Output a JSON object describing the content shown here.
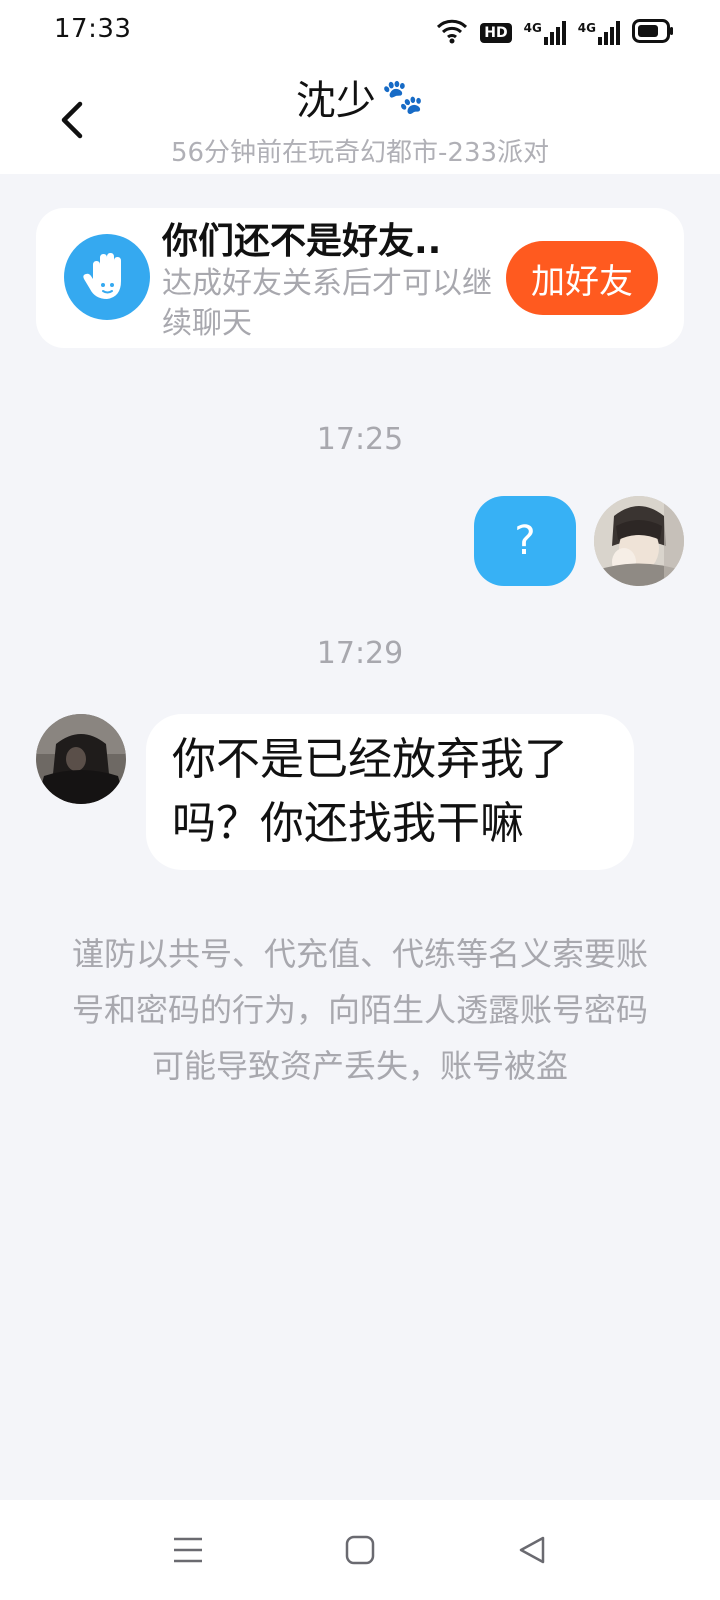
{
  "status_bar": {
    "time": "17:33",
    "icons": [
      "wifi-icon",
      "hd-icon",
      "signal-4g-icon",
      "signal-4g-icon",
      "battery-icon"
    ],
    "hd_label": "HD",
    "network_label_1": "4G",
    "network_label_2": "4G"
  },
  "header": {
    "title": "沈少",
    "title_emoji": "🐾",
    "subtitle": "56分钟前在玩奇幻都市-233派对"
  },
  "friend_card": {
    "title": "你们还不是好友..",
    "description": "达成好友关系后才可以继续聊天",
    "button_label": "加好友",
    "button_color": "#ff5a1f"
  },
  "messages": [
    {
      "time": "17:25",
      "side": "right",
      "text": "?"
    },
    {
      "time": "17:29",
      "side": "left",
      "text": "你不是已经放弃我了吗？你还找我干嘛"
    }
  ],
  "warning": "谨防以共号、代充值、代练等名义索要账号和密码的行为，向陌生人透露账号密码可能导致资产丢失，账号被盗",
  "colors": {
    "accent_blue": "#37b1f5",
    "background": "#f4f5f9"
  }
}
